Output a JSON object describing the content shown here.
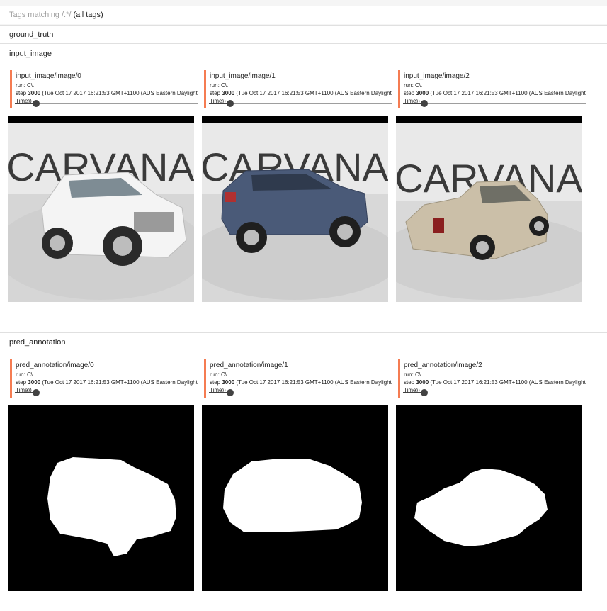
{
  "filter": {
    "prefix": "Tags matching ",
    "pattern": "/.*/",
    "suffix": " (all tags)"
  },
  "categories": {
    "ground_truth": "ground_truth",
    "input_image": "input_image",
    "pred_annotation": "pred_annotation"
  },
  "input_cards": [
    {
      "title": "input_image/image/0",
      "run": "run: C\\.",
      "step_label": "step ",
      "step": "3000",
      "time": " (Tue Oct 17 2017 16:21:53 GMT+1100 (AUS Eastern Daylight Time))",
      "logo_text": "CARVANA"
    },
    {
      "title": "input_image/image/1",
      "run": "run: C\\.",
      "step_label": "step ",
      "step": "3000",
      "time": " (Tue Oct 17 2017 16:21:53 GMT+1100 (AUS Eastern Daylight Time))",
      "logo_text": "CARVANA"
    },
    {
      "title": "input_image/image/2",
      "run": "run: C\\.",
      "step_label": "step ",
      "step": "3000",
      "time": " (Tue Oct 17 2017 16:21:53 GMT+1100 (AUS Eastern Daylight Time))",
      "logo_text": "CARVANA"
    }
  ],
  "pred_cards": [
    {
      "title": "pred_annotation/image/0",
      "run": "run: C\\.",
      "step_label": "step ",
      "step": "3000",
      "time": " (Tue Oct 17 2017 16:21:53 GMT+1100 (AUS Eastern Daylight Time))"
    },
    {
      "title": "pred_annotation/image/1",
      "run": "run: C\\.",
      "step_label": "step ",
      "step": "3000",
      "time": " (Tue Oct 17 2017 16:21:53 GMT+1100 (AUS Eastern Daylight Time))"
    },
    {
      "title": "pred_annotation/image/2",
      "run": "run: C\\.",
      "step_label": "step ",
      "step": "3000",
      "time": " (Tue Oct 17 2017 16:21:53 GMT+1100 (AUS Eastern Daylight Time))"
    }
  ],
  "colors": {
    "card_accent": "#f57c52",
    "car_0": "#f2f2f2",
    "car_1": "#4a5a78",
    "car_2": "#cbbfa8"
  }
}
